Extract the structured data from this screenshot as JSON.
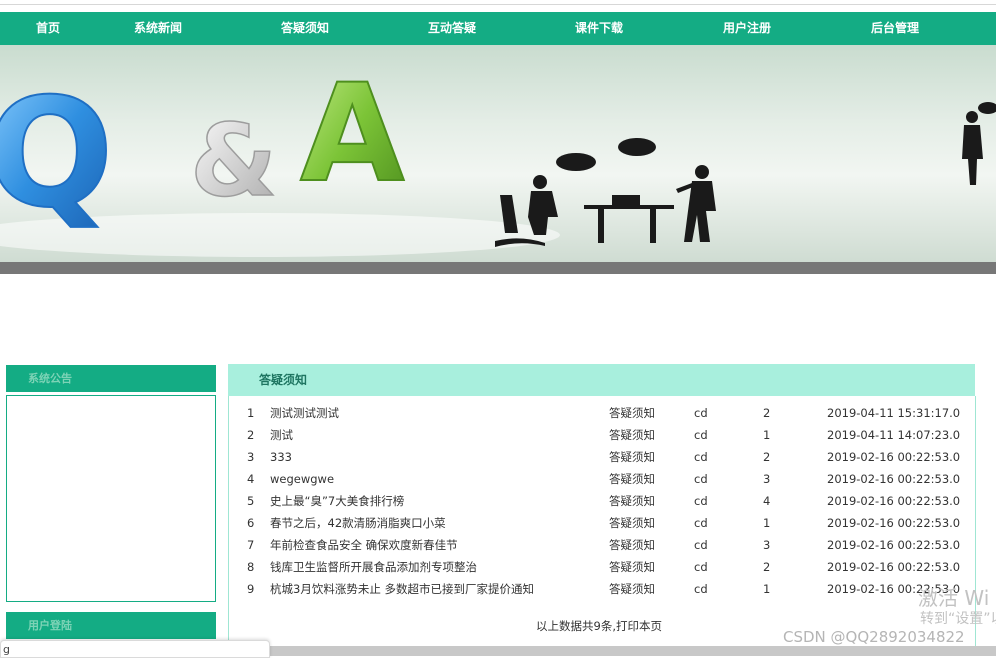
{
  "nav": {
    "items": [
      "首页",
      "系统新闻",
      "答疑须知",
      "互动答疑",
      "课件下载",
      "用户注册",
      "后台管理"
    ]
  },
  "banner": {
    "letters": [
      "Q",
      "&",
      "A"
    ],
    "colors": {
      "q": "#3a9ee8",
      "amp": "#d9d9d9",
      "a": "#7cc437",
      "silhouette": "#1a1a1a"
    }
  },
  "sidebar": {
    "notice_title": "系统公告",
    "login_title": "用户登陆"
  },
  "main": {
    "title": "答疑须知",
    "rows": [
      {
        "idx": "1",
        "title": "测试测试测试",
        "category": "答疑须知",
        "user": "cd",
        "count": "2",
        "time": "2019-04-11 15:31:17.0"
      },
      {
        "idx": "2",
        "title": "测试",
        "category": "答疑须知",
        "user": "cd",
        "count": "1",
        "time": "2019-04-11 14:07:23.0"
      },
      {
        "idx": "3",
        "title": "333",
        "category": "答疑须知",
        "user": "cd",
        "count": "2",
        "time": "2019-02-16 00:22:53.0"
      },
      {
        "idx": "4",
        "title": "wegewgwe",
        "category": "答疑须知",
        "user": "cd",
        "count": "3",
        "time": "2019-02-16 00:22:53.0"
      },
      {
        "idx": "5",
        "title": "史上最“臭”7大美食排行榜",
        "category": "答疑须知",
        "user": "cd",
        "count": "4",
        "time": "2019-02-16 00:22:53.0"
      },
      {
        "idx": "6",
        "title": "春节之后，42款清肠消脂爽口小菜",
        "category": "答疑须知",
        "user": "cd",
        "count": "1",
        "time": "2019-02-16 00:22:53.0"
      },
      {
        "idx": "7",
        "title": "年前检查食品安全 确保欢度新春佳节",
        "category": "答疑须知",
        "user": "cd",
        "count": "3",
        "time": "2019-02-16 00:22:53.0"
      },
      {
        "idx": "8",
        "title": "钱库卫生监督所开展食品添加剂专项整治",
        "category": "答疑须知",
        "user": "cd",
        "count": "2",
        "time": "2019-02-16 00:22:53.0"
      },
      {
        "idx": "9",
        "title": "杭城3月饮料涨势未止 多数超市已接到厂家提价通知",
        "category": "答疑须知",
        "user": "cd",
        "count": "1",
        "time": "2019-02-16 00:22:53.0"
      }
    ],
    "footer_prefix": "以上数据共9条,",
    "print_label": "打印本页"
  },
  "overlay": {
    "activate_text": "激活 Wi",
    "settings_text": "转到“设置”以",
    "csdn_text": "CSDN @QQ2892034822",
    "corner_text": "g"
  }
}
